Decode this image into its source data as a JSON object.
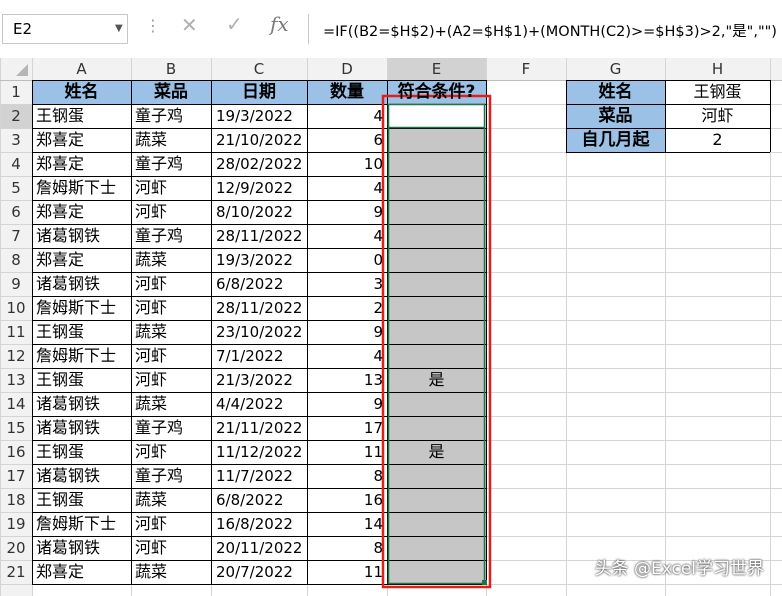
{
  "name_box": "E2",
  "formula": "=IF((B2=$H$2)+(A2=$H$1)+(MONTH(C2)>=$H$3)>2,\"是\",\"\")",
  "column_headers": [
    "A",
    "B",
    "C",
    "D",
    "E",
    "F",
    "G",
    "H"
  ],
  "row_numbers": [
    "1",
    "2",
    "3",
    "4",
    "5",
    "6",
    "7",
    "8",
    "9",
    "10",
    "11",
    "12",
    "13",
    "14",
    "15",
    "16",
    "17",
    "18",
    "19",
    "20",
    "21"
  ],
  "table_header": {
    "name": "姓名",
    "dish": "菜品",
    "date": "日期",
    "qty": "数量",
    "match": "符合条件?"
  },
  "rows": [
    {
      "name": "王钢蛋",
      "dish": "童子鸡",
      "date": "19/3/2022",
      "qty": "4",
      "match": ""
    },
    {
      "name": "郑喜定",
      "dish": "蔬菜",
      "date": "21/10/2022",
      "qty": "6",
      "match": ""
    },
    {
      "name": "郑喜定",
      "dish": "童子鸡",
      "date": "28/02/2022",
      "qty": "10",
      "match": ""
    },
    {
      "name": "詹姆斯下士",
      "dish": "河虾",
      "date": "12/9/2022",
      "qty": "4",
      "match": ""
    },
    {
      "name": "郑喜定",
      "dish": "河虾",
      "date": "8/10/2022",
      "qty": "9",
      "match": ""
    },
    {
      "name": "诸葛钢铁",
      "dish": "童子鸡",
      "date": "28/11/2022",
      "qty": "4",
      "match": ""
    },
    {
      "name": "郑喜定",
      "dish": "蔬菜",
      "date": "19/3/2022",
      "qty": "0",
      "match": ""
    },
    {
      "name": "诸葛钢铁",
      "dish": "河虾",
      "date": "6/8/2022",
      "qty": "3",
      "match": ""
    },
    {
      "name": "詹姆斯下士",
      "dish": "河虾",
      "date": "28/11/2022",
      "qty": "2",
      "match": ""
    },
    {
      "name": "王钢蛋",
      "dish": "蔬菜",
      "date": "23/10/2022",
      "qty": "9",
      "match": ""
    },
    {
      "name": "詹姆斯下士",
      "dish": "河虾",
      "date": "7/1/2022",
      "qty": "4",
      "match": ""
    },
    {
      "name": "王钢蛋",
      "dish": "河虾",
      "date": "21/3/2022",
      "qty": "13",
      "match": "是"
    },
    {
      "name": "诸葛钢铁",
      "dish": "蔬菜",
      "date": "4/4/2022",
      "qty": "9",
      "match": ""
    },
    {
      "name": "诸葛钢铁",
      "dish": "童子鸡",
      "date": "21/11/2022",
      "qty": "17",
      "match": ""
    },
    {
      "name": "王钢蛋",
      "dish": "河虾",
      "date": "11/12/2022",
      "qty": "11",
      "match": "是"
    },
    {
      "name": "诸葛钢铁",
      "dish": "童子鸡",
      "date": "11/7/2022",
      "qty": "8",
      "match": ""
    },
    {
      "name": "王钢蛋",
      "dish": "蔬菜",
      "date": "6/8/2022",
      "qty": "16",
      "match": ""
    },
    {
      "name": "詹姆斯下士",
      "dish": "河虾",
      "date": "16/8/2022",
      "qty": "14",
      "match": ""
    },
    {
      "name": "诸葛钢铁",
      "dish": "河虾",
      "date": "20/11/2022",
      "qty": "8",
      "match": ""
    },
    {
      "name": "郑喜定",
      "dish": "蔬菜",
      "date": "20/7/2022",
      "qty": "11",
      "match": ""
    }
  ],
  "criteria": [
    {
      "label": "姓名",
      "value": "王钢蛋"
    },
    {
      "label": "菜品",
      "value": "河虾"
    },
    {
      "label": "自几月起",
      "value": "2"
    }
  ],
  "watermark": "头条 @Excel学习世界",
  "colors": {
    "header_fill": "#9bc2e6",
    "selection_fill": "#c6c6c6",
    "highlight_border": "#e0201c",
    "grid": "#d4d4d4",
    "active_col": "#d2d2d2"
  }
}
